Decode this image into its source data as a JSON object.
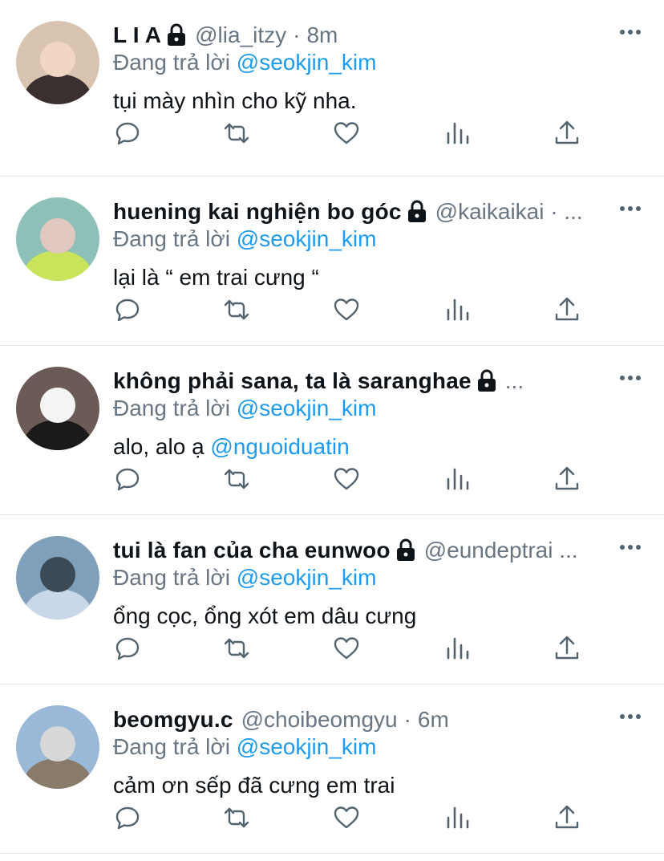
{
  "tweets": [
    {
      "name": "L I A",
      "locked": true,
      "handle": "@lia_itzy",
      "dot": "·",
      "time": "8m",
      "reply_prefix": "Đang trả lời ",
      "reply_to": "@seokjin_kim",
      "text_before": "tụi mày nhìn cho kỹ nha.",
      "text_mention": "",
      "avatar_colors": [
        "#d8c4b0",
        "#3a3030",
        "#f2d6c4"
      ]
    },
    {
      "name": "huening kai nghiện bo góc",
      "locked": true,
      "handle": "@kaikaikai · ...",
      "dot": "",
      "time": "",
      "reply_prefix": "Đang trả lời ",
      "reply_to": "@seokjin_kim",
      "text_before": "lại là “ em trai cưng “",
      "text_mention": "",
      "avatar_colors": [
        "#8ec0b8",
        "#c9e35a",
        "#e0c8c0"
      ]
    },
    {
      "name": "không phải sana, ta là saranghae",
      "locked": true,
      "handle": "...",
      "dot": "",
      "time": "",
      "reply_prefix": "Đang trả lời ",
      "reply_to": "@seokjin_kim",
      "text_before": "alo, alo ạ ",
      "text_mention": "@nguoiduatin",
      "avatar_colors": [
        "#6b5a55",
        "#1a1a1a",
        "#f4f4f4"
      ]
    },
    {
      "name": "tui là fan của cha eunwoo",
      "locked": true,
      "handle": "@eundeptrai ...",
      "dot": "",
      "time": "",
      "reply_prefix": "Đang trả lời ",
      "reply_to": "@seokjin_kim",
      "text_before": "ổng cọc, ổng xót em dâu cưng",
      "text_mention": "",
      "avatar_colors": [
        "#7fa0b8",
        "#c8d8e8",
        "#3c4a55"
      ]
    },
    {
      "name": "beomgyu.c",
      "locked": false,
      "handle": "@choibeomgyu",
      "dot": "·",
      "time": "6m",
      "reply_prefix": "Đang trả lời ",
      "reply_to": "@seokjin_kim",
      "text_before": "cảm ơn sếp đã cưng em trai",
      "text_mention": "",
      "avatar_colors": [
        "#9ab8d8",
        "#8a7a6a",
        "#d8d8d8"
      ]
    }
  ],
  "icons": {
    "more": "more-icon",
    "reply": "reply-icon",
    "retweet": "retweet-icon",
    "like": "heart-icon",
    "views": "views-icon",
    "share": "share-icon",
    "lock": "lock-icon"
  },
  "colors": {
    "text": "#0f1419",
    "muted": "#687684",
    "link": "#1d9bf0",
    "divider": "#e1e5e8"
  }
}
